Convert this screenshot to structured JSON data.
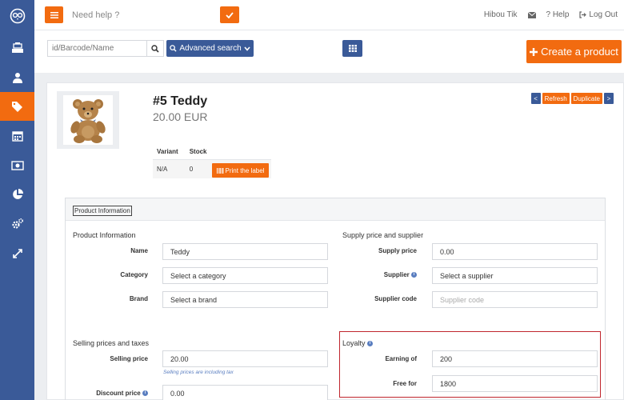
{
  "sidebar": {
    "items": [
      {
        "icon": "owl-logo-icon"
      },
      {
        "icon": "cash-register-icon"
      },
      {
        "icon": "user-icon"
      },
      {
        "icon": "tags-icon",
        "active": true
      },
      {
        "icon": "calendar-icon"
      },
      {
        "icon": "banknote-icon"
      },
      {
        "icon": "pie-chart-icon"
      },
      {
        "icon": "cogs-icon"
      },
      {
        "icon": "expand-icon"
      }
    ]
  },
  "topbar": {
    "help_text": "Need help ?",
    "user_name": "Hibou Tik",
    "help_label": "? Help",
    "logout_label": "Log Out"
  },
  "search": {
    "placeholder": "id/Barcode/Name",
    "advanced_label": "Advanced search",
    "create_label": "Create a product"
  },
  "product": {
    "title": "#5 Teddy",
    "price": "20.00 EUR",
    "prev_label": "<",
    "refresh_label": "Refresh",
    "duplicate_label": "Duplicate",
    "next_label": ">",
    "variants": {
      "headers": [
        "Variant",
        "Stock"
      ],
      "rows": [
        {
          "variant": "N/A",
          "stock": "0"
        }
      ],
      "print_label": "Print the label"
    }
  },
  "panel": {
    "tab_label": "Product Information",
    "product_info": {
      "title": "Product Information",
      "name_label": "Name",
      "name_value": "Teddy",
      "category_label": "Category",
      "category_value": "Select a category",
      "brand_label": "Brand",
      "brand_value": "Select a brand"
    },
    "supply": {
      "title": "Supply price and supplier",
      "price_label": "Supply price",
      "price_value": "0.00",
      "supplier_label": "Supplier",
      "supplier_value": "Select a supplier",
      "code_label": "Supplier code",
      "code_placeholder": "Supplier code"
    },
    "selling": {
      "title": "Selling prices and taxes",
      "price_label": "Selling price",
      "price_value": "20.00",
      "hint": "Selling prices are including tax",
      "discount_label": "Discount price",
      "discount_value": "0.00"
    },
    "loyalty": {
      "title": "Loyalty",
      "earning_label": "Earning of",
      "earning_value": "200",
      "free_label": "Free for",
      "free_value": "1800"
    }
  },
  "colors": {
    "sidebar": "#3a5a98",
    "accent": "#f26b10",
    "highlight": "#c0262d"
  }
}
